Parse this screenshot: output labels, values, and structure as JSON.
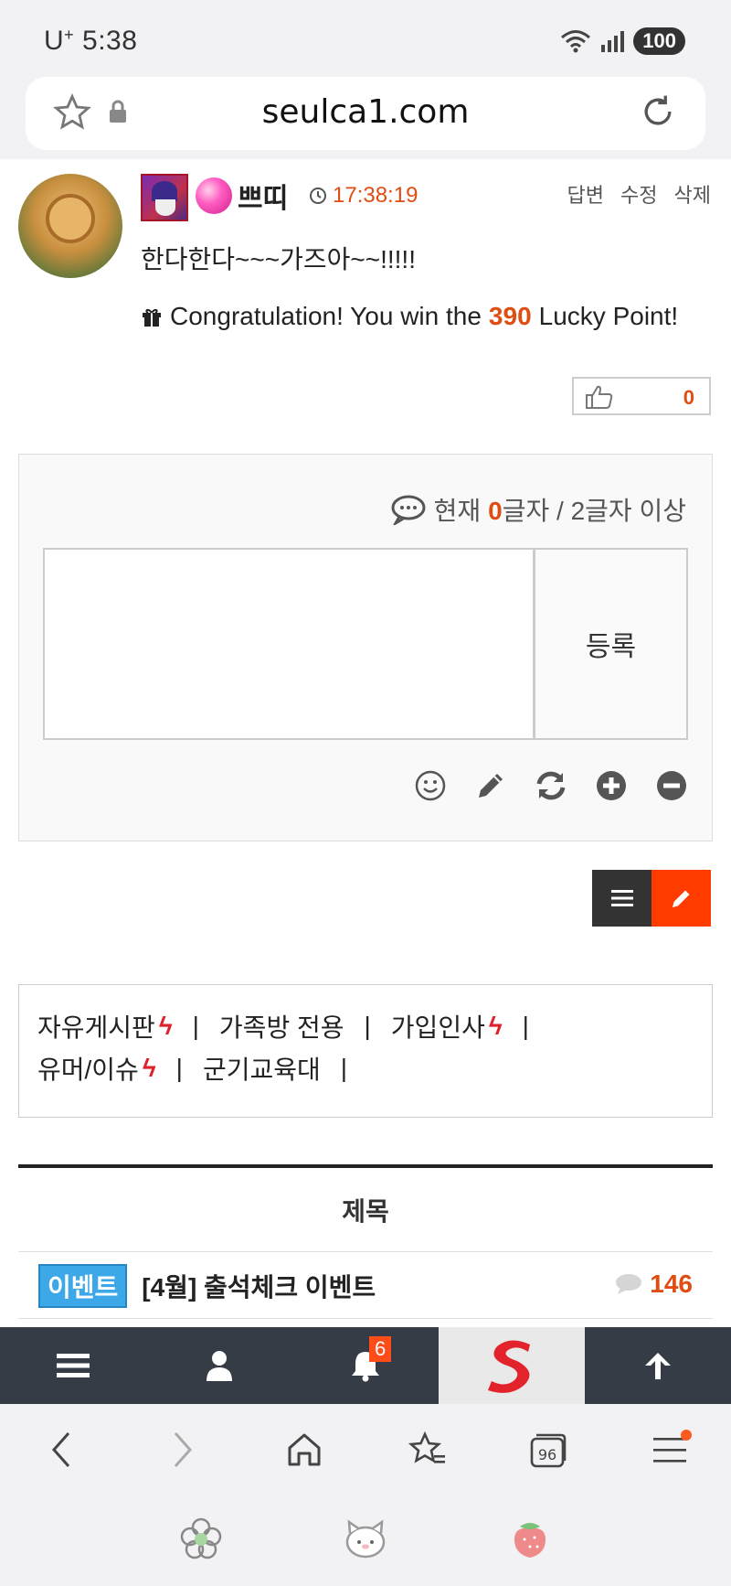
{
  "status_bar": {
    "carrier": "U",
    "carrier_sup": "+",
    "time": "5:38",
    "battery": "100"
  },
  "browser": {
    "url": "seulca1.com"
  },
  "comment": {
    "nickname": "쁘띠",
    "time": "17:38:19",
    "actions": [
      "답변",
      "수정",
      "삭제"
    ],
    "text": "한다한다~~~가즈아~~!!!!!",
    "lucky_prefix": "Congratulation! You win the",
    "lucky_points": "390",
    "lucky_suffix": "Lucky Point!",
    "likes": "0"
  },
  "reply": {
    "counter_prefix": "현재",
    "counter_value": "0",
    "counter_suffix": "글자 / 2글자 이상",
    "submit_label": "등록",
    "tools": [
      "smile-icon",
      "pencil-icon",
      "refresh-icon",
      "plus-icon",
      "minus-icon"
    ]
  },
  "categories": [
    {
      "label": "자유게시판",
      "hot": true
    },
    {
      "label": "가족방 전용",
      "hot": false
    },
    {
      "label": "가입인사",
      "hot": true
    },
    {
      "label": "유머/이슈",
      "hot": true
    },
    {
      "label": "군기교육대",
      "hot": false
    }
  ],
  "board": {
    "header": "제목",
    "rows": [
      {
        "tag": "이벤트",
        "title": "[4월] 출석체크 이벤트",
        "comments": "146"
      }
    ]
  },
  "app_nav": {
    "notification_count": "6"
  },
  "colors": {
    "accent": "#e04d12",
    "nav_bg": "#353c45",
    "tag": "#3ca8e8",
    "write_button": "#ff3b00"
  }
}
